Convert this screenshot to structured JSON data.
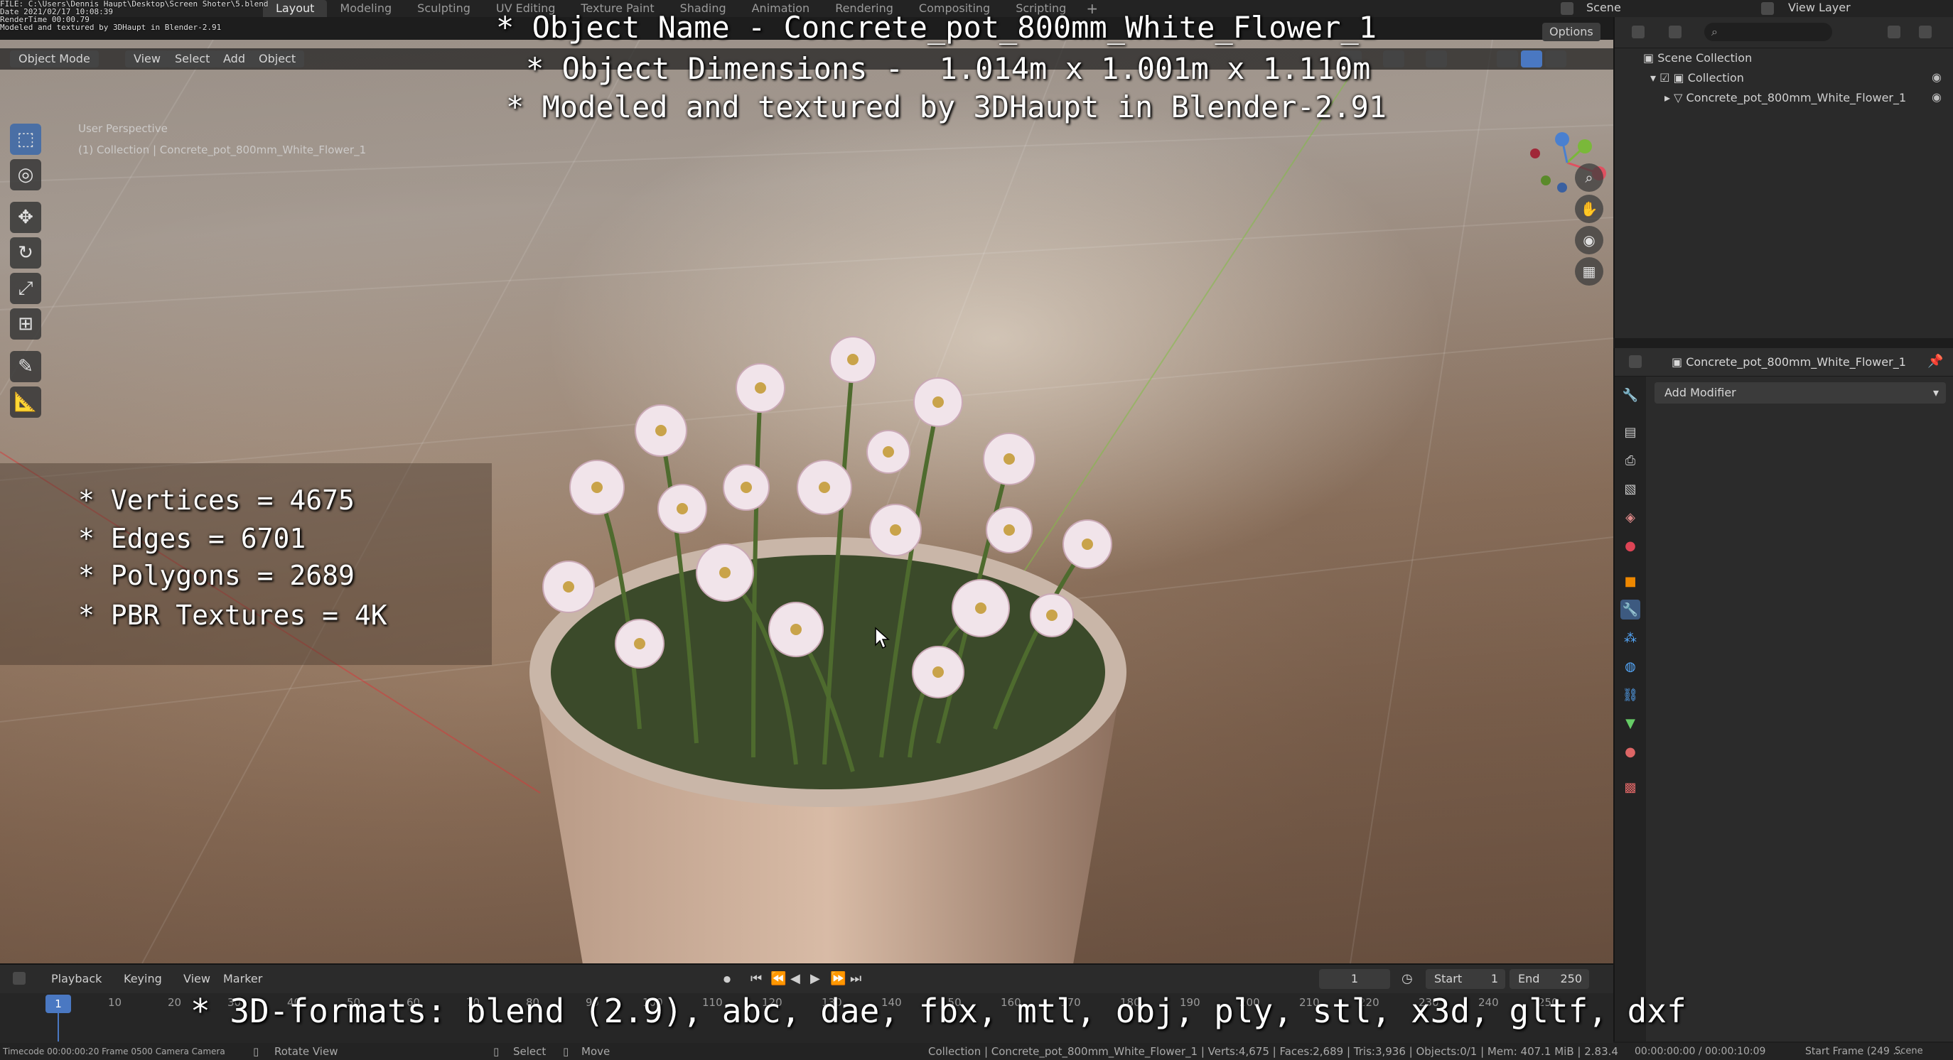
{
  "topbar": {
    "tabs": [
      "Layout",
      "Modeling",
      "Sculpting",
      "UV Editing",
      "Texture Paint",
      "Shading",
      "Animation",
      "Rendering",
      "Compositing",
      "Scripting"
    ],
    "add_tab": "+",
    "scene": "Scene",
    "view_layer": "View Layer"
  },
  "info_lines": {
    "file": "FILE: C:\\Users\\Dennis Haupt\\Desktop\\Screen Shoter\\5.blend",
    "date": "Date 2021/02/17 10:08:39",
    "rendertime": "RenderTime 00:00.79",
    "modeled": "Modeled and textured by 3DHaupt in Blender-2.91"
  },
  "viewport": {
    "mode": "Object Mode",
    "menus": [
      "View",
      "Select",
      "Add",
      "Object"
    ],
    "options": "Options",
    "perspective": "User Perspective",
    "collection_path": "(1) Collection | Concrete_pot_800mm_White_Flower_1"
  },
  "overlay": {
    "line1": "* Object Name - Concrete_pot_800mm_White_Flower_1",
    "line2": "* Object Dimensions -  1.014m x 1.001m x 1.110m",
    "line3": "* Modeled and textured by 3DHaupt in Blender-2.91",
    "stats": [
      "* Vertices = 4675",
      "* Edges = 6701",
      "* Polygons = 2689",
      "* PBR Textures = 4K"
    ],
    "formats": "* 3D-formats: blend (2.9), abc, dae, fbx, mtl, obj, ply, stl, x3d, gltf, dxf"
  },
  "outliner": {
    "scene_collection": "Scene Collection",
    "collection": "Collection",
    "object": "Concrete_pot_800mm_White_Flower_1"
  },
  "properties": {
    "object_name": "Concrete_pot_800mm_White_Flower_1",
    "add_modifier": "Add Modifier"
  },
  "timeline": {
    "menus": [
      "Playback",
      "Keying",
      "View",
      "Marker"
    ],
    "current_frame": "1",
    "start_label": "Start",
    "start": "1",
    "end_label": "End",
    "end": "250",
    "ticks": [
      "1",
      "10",
      "20",
      "30",
      "40",
      "50",
      "60",
      "70",
      "80",
      "90",
      "100",
      "110",
      "120",
      "130",
      "140",
      "150",
      "160",
      "170",
      "180",
      "190",
      "200",
      "210",
      "220",
      "230",
      "240",
      "250"
    ]
  },
  "statusbar": {
    "left": "Timecode 00:00:00:20  Frame 0500  Camera Camera",
    "rotate": "Rotate View",
    "select": "Select",
    "move": "Move",
    "stats": "Collection | Concrete_pot_800mm_White_Flower_1 | Verts:4,675 | Faces:2,689 | Tris:3,936 | Objects:0/1 | Mem: 407.1 MiB | 2.83.4",
    "timecode": "00:00:00:00 / 00:00:10:09",
    "start_frame": "Start Frame (249 ...",
    "scene": "Scene"
  },
  "colors": {
    "accent_blue": "#4a78c2",
    "active_tool": "#4a6fa5",
    "panel_bg": "#2b2b2b"
  }
}
